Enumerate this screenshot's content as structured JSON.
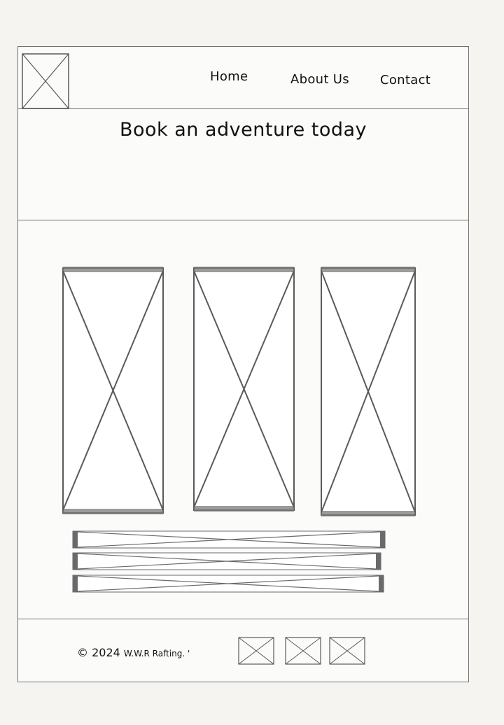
{
  "header": {
    "logo_icon": "image-placeholder-icon",
    "nav": {
      "home": "Home",
      "about": "About Us",
      "contact": "Contact"
    }
  },
  "hero": {
    "title": "Book an adventure today"
  },
  "main": {
    "cards": [
      {
        "icon": "image-placeholder-icon"
      },
      {
        "icon": "image-placeholder-icon"
      },
      {
        "icon": "image-placeholder-icon"
      }
    ],
    "bars": [
      {
        "icon": "image-placeholder-icon"
      },
      {
        "icon": "image-placeholder-icon"
      },
      {
        "icon": "image-placeholder-icon"
      }
    ]
  },
  "footer": {
    "copyright_year": "© 2024",
    "copyright_brand": "W.W.R Rafting. '",
    "social_icons": [
      "image-placeholder-icon",
      "image-placeholder-icon",
      "image-placeholder-icon"
    ]
  },
  "colors": {
    "page_bg": "#f5f4f1",
    "frame_line": "#6f6f6f",
    "placeholder_stroke": "#5a5a5a",
    "text": "#111111"
  }
}
